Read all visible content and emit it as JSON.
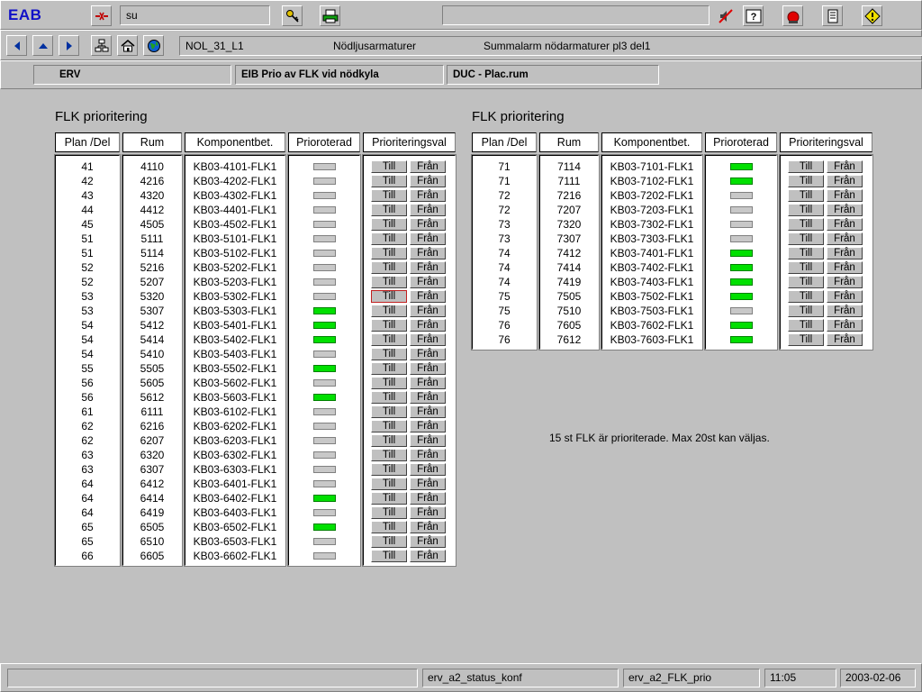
{
  "app": {
    "logo": "EAB",
    "user": "su"
  },
  "nav": {
    "object": "NOL_31_L1",
    "group": "Nödljusarmaturer",
    "alarm": "Summalarm nödarmaturer pl3 del1"
  },
  "context": {
    "system": "ERV",
    "function": "EIB Prio av FLK vid nödkyla",
    "duc": "DUC -  Plac.rum"
  },
  "headers": {
    "plan": "Plan /Del",
    "rum": "Rum",
    "komponent": "Komponentbet.",
    "prio": "Prioroterad",
    "val": "Prioriteringsval"
  },
  "buttons": {
    "till": "Till",
    "fran": "Från"
  },
  "tables": [
    {
      "title": "FLK prioritering",
      "rows": [
        {
          "plan": "41",
          "rum": "4110",
          "komp": "KB03-4101-FLK1",
          "prio": false
        },
        {
          "plan": "42",
          "rum": "4216",
          "komp": "KB03-4202-FLK1",
          "prio": false
        },
        {
          "plan": "43",
          "rum": "4320",
          "komp": "KB03-4302-FLK1",
          "prio": false
        },
        {
          "plan": "44",
          "rum": "4412",
          "komp": "KB03-4401-FLK1",
          "prio": false
        },
        {
          "plan": "45",
          "rum": "4505",
          "komp": "KB03-4502-FLK1",
          "prio": false
        },
        {
          "plan": "51",
          "rum": "5111",
          "komp": "KB03-5101-FLK1",
          "prio": false
        },
        {
          "plan": "51",
          "rum": "5114",
          "komp": "KB03-5102-FLK1",
          "prio": false
        },
        {
          "plan": "52",
          "rum": "5216",
          "komp": "KB03-5202-FLK1",
          "prio": false
        },
        {
          "plan": "52",
          "rum": "5207",
          "komp": "KB03-5203-FLK1",
          "prio": false
        },
        {
          "plan": "53",
          "rum": "5320",
          "komp": "KB03-5302-FLK1",
          "prio": false,
          "selected": true
        },
        {
          "plan": "53",
          "rum": "5307",
          "komp": "KB03-5303-FLK1",
          "prio": true
        },
        {
          "plan": "54",
          "rum": "5412",
          "komp": "KB03-5401-FLK1",
          "prio": true
        },
        {
          "plan": "54",
          "rum": "5414",
          "komp": "KB03-5402-FLK1",
          "prio": true
        },
        {
          "plan": "54",
          "rum": "5410",
          "komp": "KB03-5403-FLK1",
          "prio": false
        },
        {
          "plan": "55",
          "rum": "5505",
          "komp": "KB03-5502-FLK1",
          "prio": true
        },
        {
          "plan": "56",
          "rum": "5605",
          "komp": "KB03-5602-FLK1",
          "prio": false
        },
        {
          "plan": "56",
          "rum": "5612",
          "komp": "KB03-5603-FLK1",
          "prio": true
        },
        {
          "plan": "61",
          "rum": "6111",
          "komp": "KB03-6102-FLK1",
          "prio": false
        },
        {
          "plan": "62",
          "rum": "6216",
          "komp": "KB03-6202-FLK1",
          "prio": false
        },
        {
          "plan": "62",
          "rum": "6207",
          "komp": "KB03-6203-FLK1",
          "prio": false
        },
        {
          "plan": "63",
          "rum": "6320",
          "komp": "KB03-6302-FLK1",
          "prio": false
        },
        {
          "plan": "63",
          "rum": "6307",
          "komp": "KB03-6303-FLK1",
          "prio": false
        },
        {
          "plan": "64",
          "rum": "6412",
          "komp": "KB03-6401-FLK1",
          "prio": false
        },
        {
          "plan": "64",
          "rum": "6414",
          "komp": "KB03-6402-FLK1",
          "prio": true
        },
        {
          "plan": "64",
          "rum": "6419",
          "komp": "KB03-6403-FLK1",
          "prio": false
        },
        {
          "plan": "65",
          "rum": "6505",
          "komp": "KB03-6502-FLK1",
          "prio": true
        },
        {
          "plan": "65",
          "rum": "6510",
          "komp": "KB03-6503-FLK1",
          "prio": false
        },
        {
          "plan": "66",
          "rum": "6605",
          "komp": "KB03-6602-FLK1",
          "prio": false
        }
      ]
    },
    {
      "title": "FLK prioritering",
      "rows": [
        {
          "plan": "71",
          "rum": "7114",
          "komp": "KB03-7101-FLK1",
          "prio": true
        },
        {
          "plan": "71",
          "rum": "7111",
          "komp": "KB03-7102-FLK1",
          "prio": true
        },
        {
          "plan": "72",
          "rum": "7216",
          "komp": "KB03-7202-FLK1",
          "prio": false
        },
        {
          "plan": "72",
          "rum": "7207",
          "komp": "KB03-7203-FLK1",
          "prio": false
        },
        {
          "plan": "73",
          "rum": "7320",
          "komp": "KB03-7302-FLK1",
          "prio": false
        },
        {
          "plan": "73",
          "rum": "7307",
          "komp": "KB03-7303-FLK1",
          "prio": false
        },
        {
          "plan": "74",
          "rum": "7412",
          "komp": "KB03-7401-FLK1",
          "prio": true
        },
        {
          "plan": "74",
          "rum": "7414",
          "komp": "KB03-7402-FLK1",
          "prio": true
        },
        {
          "plan": "74",
          "rum": "7419",
          "komp": "KB03-7403-FLK1",
          "prio": true
        },
        {
          "plan": "75",
          "rum": "7505",
          "komp": "KB03-7502-FLK1",
          "prio": true
        },
        {
          "plan": "75",
          "rum": "7510",
          "komp": "KB03-7503-FLK1",
          "prio": false
        },
        {
          "plan": "76",
          "rum": "7605",
          "komp": "KB03-7602-FLK1",
          "prio": true
        },
        {
          "plan": "76",
          "rum": "7612",
          "komp": "KB03-7603-FLK1",
          "prio": true
        }
      ]
    }
  ],
  "note": "15  st  FLK är prioriterade. Max 20st kan väljas.",
  "status": {
    "message": "",
    "picture": "erv_a2_status_konf",
    "view": "erv_a2_FLK_prio",
    "time": "11:05",
    "date": "2003-02-06"
  },
  "colors": {
    "on": "#00e000",
    "off": "#c8c8c8",
    "logo": "#1010c8"
  },
  "icons": {
    "toolbar": [
      "disconnect-icon",
      "key-icon",
      "printer-icon",
      "no-sound-icon",
      "help-icon",
      "alarm-bell-icon",
      "notepad-icon",
      "warning-icon"
    ],
    "nav": [
      "arrow-left-icon",
      "arrow-up-icon",
      "arrow-right-icon",
      "tree-icon",
      "home-icon",
      "globe-icon"
    ]
  }
}
